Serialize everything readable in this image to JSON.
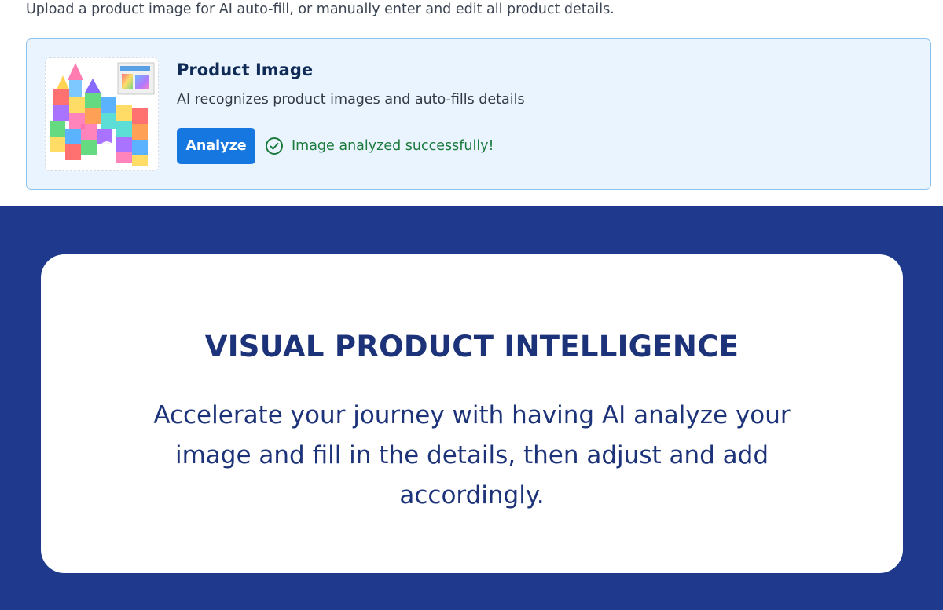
{
  "intro": {
    "text": "Upload a product image for AI auto-fill, or manually enter and edit all product details."
  },
  "product_card": {
    "title": "Product Image",
    "subtitle": "AI recognizes product images and auto-fills details",
    "analyze_label": "Analyze",
    "status_text": "Image analyzed successfully!",
    "status_icon": "check-circle-icon",
    "image_label": "magnetic-tiles-product-image"
  },
  "feature": {
    "title": "VISUAL PRODUCT INTELLIGENCE",
    "description": "Accelerate your journey with having AI analyze your image and fill in the details, then adjust and add accordingly."
  },
  "colors": {
    "accent": "#1677e0",
    "brand_navy": "#1f3a8c",
    "success": "#1b7a3c",
    "card_bg": "#e9f4ff"
  }
}
